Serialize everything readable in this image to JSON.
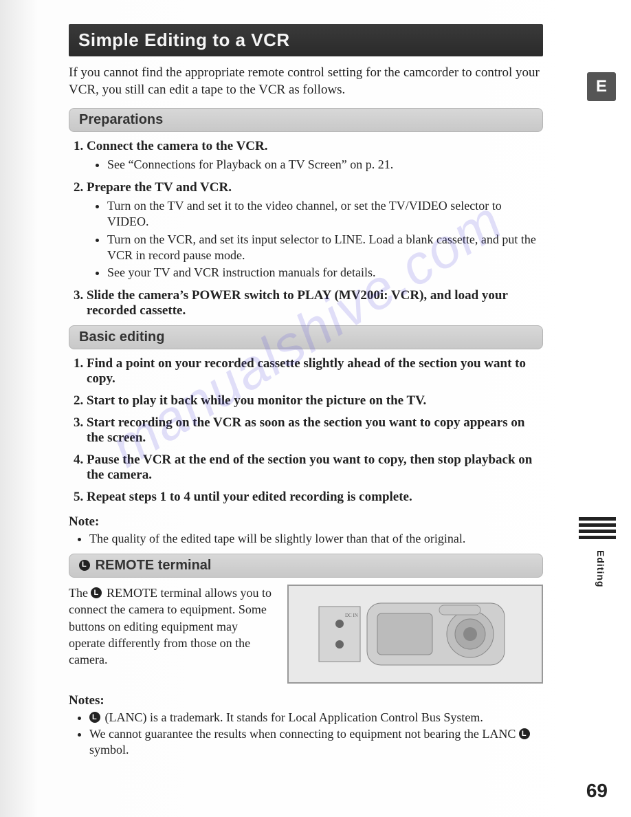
{
  "badge": "E",
  "side_label": "Editing",
  "page_number": "69",
  "watermark": "manualshive.com",
  "title": "Simple Editing to a VCR",
  "intro": "If you cannot find the appropriate remote control setting for the camcorder to control your VCR, you still can edit a tape to the VCR as follows.",
  "sections": {
    "preparations": {
      "heading": "Preparations",
      "items": [
        {
          "head": "Connect the camera to the VCR.",
          "bullets": [
            "See “Connections for Playback on a TV Screen” on p. 21."
          ]
        },
        {
          "head": "Prepare the TV and VCR.",
          "bullets": [
            "Turn on the TV and set it to the video channel, or set the TV/VIDEO selector to VIDEO.",
            "Turn on the VCR, and set its input selector to LINE. Load a blank cassette, and put the VCR in record pause mode.",
            "See your TV and VCR instruction manuals for details."
          ]
        },
        {
          "head": "Slide the camera’s POWER switch to PLAY (MV200i: VCR), and load your recorded cassette.",
          "bullets": []
        }
      ]
    },
    "basic": {
      "heading": "Basic editing",
      "items": [
        "Find a point on your recorded cassette slightly ahead of the section you want to copy.",
        "Start to play it back while you monitor the picture on the TV.",
        "Start recording on the VCR as soon as the section you want to copy appears on the screen.",
        "Pause the VCR at the end of the section you want to copy, then stop playback on the camera.",
        "Repeat steps 1 to 4 until your edited recording is complete."
      ]
    },
    "note1": {
      "head": "Note:",
      "bullets": [
        "The quality of the edited tape will be slightly lower than that of the original."
      ]
    },
    "remote": {
      "heading": "REMOTE terminal",
      "body_pre": "The ",
      "body_post": " REMOTE terminal allows you to connect the camera to equipment. Some buttons on editing equipment may operate differently from those on the camera."
    },
    "notes2": {
      "head": "Notes:",
      "b1_pre": "",
      "b1_post": " (LANC) is a trademark. It stands for Local Application Control Bus System.",
      "b2_pre": "We cannot guarantee the results when connecting to equipment not bearing the LANC ",
      "b2_post": " symbol."
    }
  }
}
